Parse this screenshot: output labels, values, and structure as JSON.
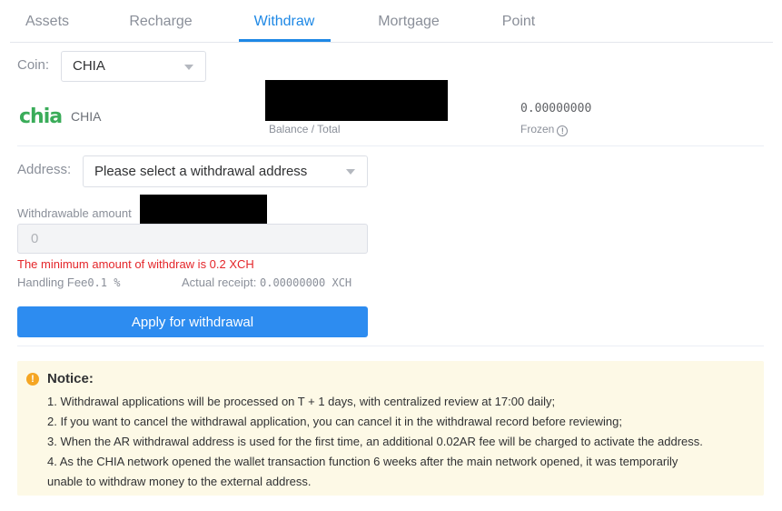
{
  "tabs": {
    "assets": "Assets",
    "recharge": "Recharge",
    "withdraw": "Withdraw",
    "mortgage": "Mortgage",
    "point": "Point",
    "active": "Withdraw"
  },
  "coin": {
    "label": "Coin:",
    "selected": "CHIA",
    "logo_text": "chia",
    "name": "CHIA"
  },
  "balance": {
    "label": "Balance / Total",
    "frozen_value": "0.00000000",
    "frozen_label": "Frozen",
    "info_icon": "info-circle-icon"
  },
  "address": {
    "label": "Address:",
    "placeholder": "Please select a withdrawal address"
  },
  "amount": {
    "withdrawable_label": "Withdrawable amount",
    "placeholder": "0",
    "min_message": "The minimum amount of withdraw is 0.2 XCH",
    "fee_label": "Handling Fee",
    "fee_value": "0.1 %",
    "receipt_label": "Actual receipt:",
    "receipt_value": "0.00000000 XCH"
  },
  "apply_button": "Apply for withdrawal",
  "notice": {
    "icon": "warning-icon",
    "title": "Notice:",
    "lines": [
      "1. Withdrawal applications will be processed on T + 1 days, with centralized review at 17:00 daily;",
      "2. If you want to cancel the withdrawal application, you can cancel it in the withdrawal record before reviewing;",
      "3. When the AR withdrawal address is used for the first time, an additional 0.02AR fee will be charged to activate the address.",
      "4. As the CHIA network opened the wallet transaction function 6 weeks after the main network opened, it was temporarily",
      "unable to withdraw money to the external address."
    ]
  },
  "colors": {
    "accent": "#1e88e5",
    "button": "#2d8cf0",
    "error": "#e4262a",
    "chia_green": "#3aac59",
    "notice_bg": "#fdf9e6",
    "warning": "#f5a623"
  }
}
